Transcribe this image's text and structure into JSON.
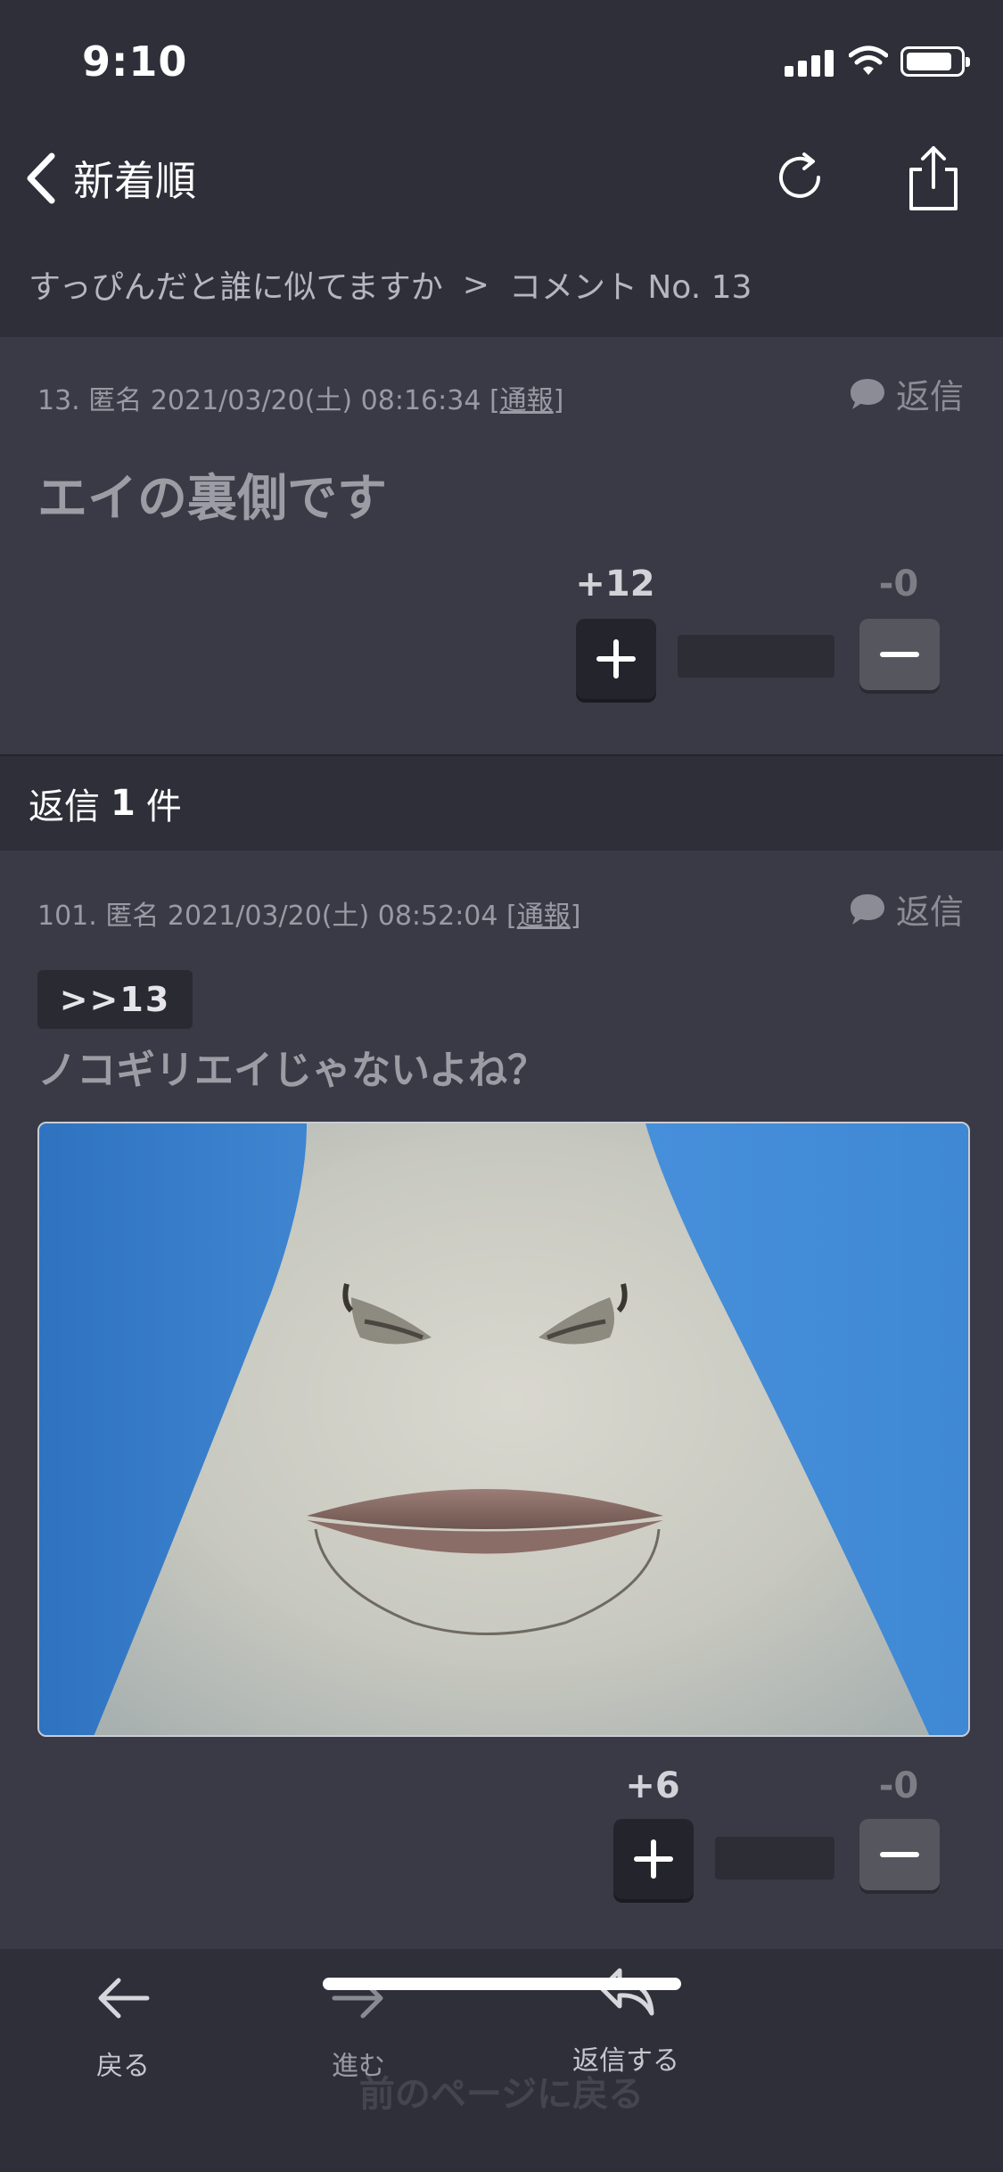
{
  "status_bar": {
    "time": "9:10"
  },
  "nav": {
    "back_label": "新着順"
  },
  "breadcrumb": {
    "topic": "すっぴんだと誰に似てますか",
    "separator": ">",
    "current": "コメント No. 13"
  },
  "comment": {
    "number": "13.",
    "author": "匿名",
    "datetime": "2021/03/20(土) 08:16:34",
    "report_label": "通報",
    "reply_label": "返信",
    "body": "エイの裏側です",
    "plus_count": "+12",
    "minus_count": "-0"
  },
  "replies_header": {
    "prefix": "返信",
    "count": "1",
    "suffix": "件"
  },
  "reply": {
    "number": "101.",
    "author": "匿名",
    "datetime": "2021/03/20(土) 08:52:04",
    "report_label": "通報",
    "reply_label": "返信",
    "quote": ">>13",
    "body": "ノコギリエイじゃないよね？",
    "image_subject": "stingray-underside-photo",
    "plus_count": "+6",
    "minus_count": "-0"
  },
  "toolbar": {
    "back_label": "戻る",
    "forward_label": "進む",
    "reply_label": "返信する",
    "ghost_text": "前のページに戻る"
  },
  "colors": {
    "background": "#3a3a46",
    "header": "#2f2f3a",
    "photo_backdrop": "#3b84cf"
  }
}
